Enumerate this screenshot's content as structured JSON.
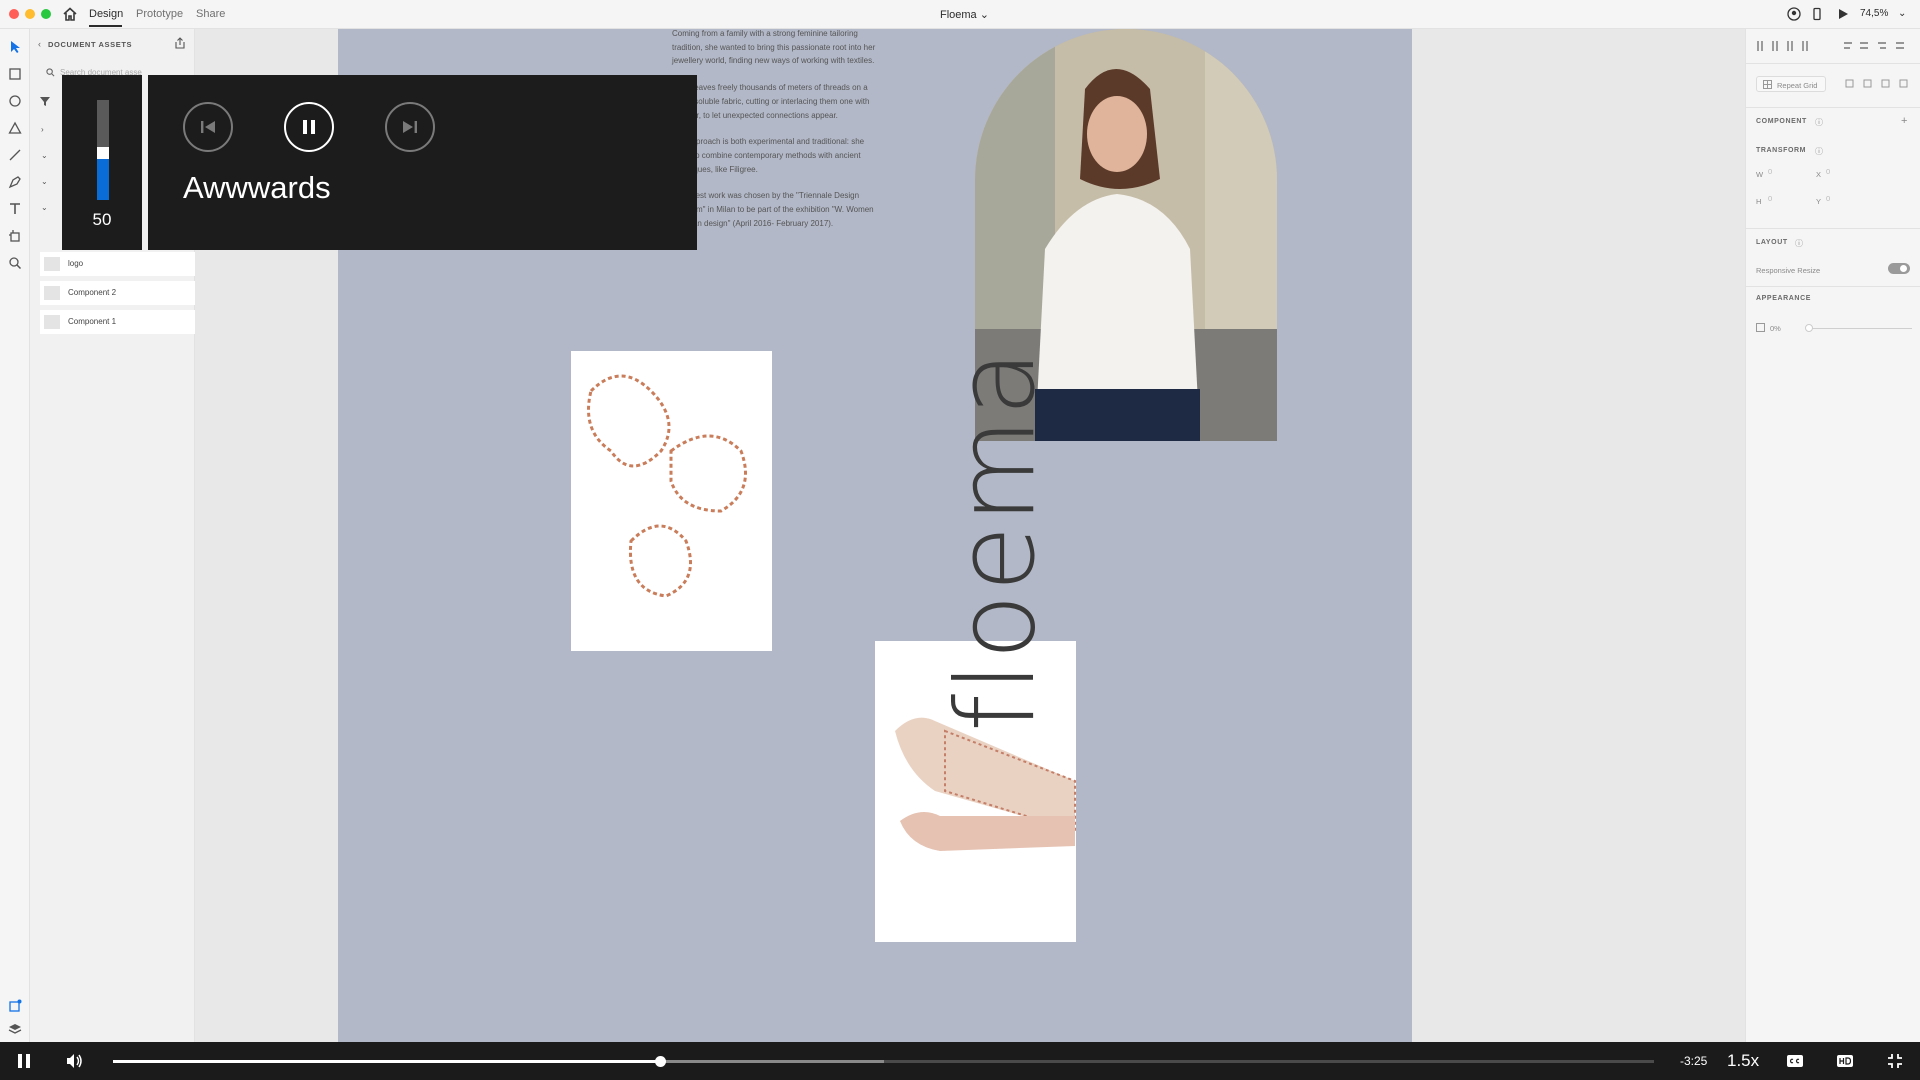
{
  "topbar": {
    "tabs": [
      "Design",
      "Prototype",
      "Share"
    ],
    "doc_title": "Floema",
    "zoom": "74,5%"
  },
  "assets": {
    "title": "DOCUMENT ASSETS",
    "search_placeholder": "Search document asse",
    "components": [
      {
        "label": "logo",
        "has_badge": true
      },
      {
        "label": "Component 2",
        "has_badge": false
      },
      {
        "label": "Component 1",
        "has_badge": false
      }
    ]
  },
  "artboard": {
    "bio": [
      "Coming from a family with a strong feminine tailoring tradition, she wanted to bring this passionate root into her jewellery world, finding new ways of working with textiles.",
      "She weaves freely thousands of meters of threads on a water-soluble fabric, cutting or interlacing them one with another, to let unexpected connections appear.",
      "Her approach is both experimental and traditional: she loves to combine contemporary methods with ancient techniques, like Filigree.",
      "Her latest work was chosen by the \"Triennale Design Museum\" in Milan to be part of the exhibition \"W. Women in Italian design\" (April 2016- February 2017)."
    ],
    "vertical_title": "floema"
  },
  "properties": {
    "repeat_grid": "Repeat Grid",
    "component": "COMPONENT",
    "transform": "TRANSFORM",
    "w": "W",
    "w_val": "0",
    "x": "X",
    "x_val": "0",
    "h": "H",
    "h_val": "0",
    "y": "Y",
    "y_val": "0",
    "layout": "LAYOUT",
    "responsive_resize": "Responsive Resize",
    "appearance": "APPEARANCE",
    "opacity": "0%"
  },
  "overlay": {
    "volume": 50,
    "volume_label": "50",
    "media_title": "Awwwards"
  },
  "player": {
    "progress": 0.355,
    "buffered": 0.5,
    "time_remaining": "-3:25",
    "speed": "1.5x"
  },
  "colors": {
    "artboard_bg": "#b2b8c7",
    "accent_blue": "#0a6cd6",
    "badge_red": "#e1251b"
  }
}
